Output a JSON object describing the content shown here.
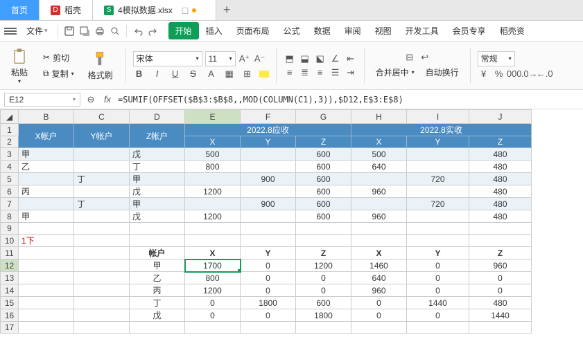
{
  "tabs": {
    "home": "首页",
    "docer": "稻壳",
    "file": "4模拟数据.xlsx"
  },
  "menubar": {
    "file": "文件"
  },
  "menutabs": {
    "start": "开始",
    "insert": "插入",
    "layout": "页面布局",
    "formula": "公式",
    "data": "数据",
    "review": "审阅",
    "view": "视图",
    "dev": "开发工具",
    "member": "会员专享",
    "docer": "稻壳资"
  },
  "ribbon": {
    "paste": "粘贴",
    "cut": "剪切",
    "copy": "复制",
    "brush": "格式刷",
    "font": "宋体",
    "size": "11",
    "merge": "合并居中",
    "wrap": "自动换行",
    "style": "常规"
  },
  "namebox": "E12",
  "formula": "=SUMIF(OFFSET($B$3:$B$8,,MOD(COLUMN(C1),3)),$D12,E$3:E$8)",
  "cols": [
    "B",
    "C",
    "D",
    "E",
    "F",
    "G",
    "H",
    "I",
    "J"
  ],
  "hdr": {
    "xacct": "X帐户",
    "yacct": "Y帐户",
    "zacct": "Z帐户",
    "ys": "2022.8应收",
    "ss": "2022.8实收",
    "x": "X",
    "y": "Y",
    "z": "Z"
  },
  "rows": [
    {
      "r": 3,
      "b": "甲",
      "c": "",
      "d": "戊",
      "e": "500",
      "f": "",
      "g": "600",
      "h": "500",
      "i": "",
      "j": "480"
    },
    {
      "r": 4,
      "b": "乙",
      "c": "",
      "d": "丁",
      "e": "800",
      "f": "",
      "g": "600",
      "h": "640",
      "i": "",
      "j": "480"
    },
    {
      "r": 5,
      "b": "",
      "c": "丁",
      "d": "甲",
      "e": "",
      "f": "900",
      "g": "600",
      "h": "",
      "i": "720",
      "j": "480"
    },
    {
      "r": 6,
      "b": "丙",
      "c": "",
      "d": "戊",
      "e": "1200",
      "f": "",
      "g": "600",
      "h": "960",
      "i": "",
      "j": "480"
    },
    {
      "r": 7,
      "b": "",
      "c": "丁",
      "d": "甲",
      "e": "",
      "f": "900",
      "g": "600",
      "h": "",
      "i": "720",
      "j": "480"
    },
    {
      "r": 8,
      "b": "甲",
      "c": "",
      "d": "戊",
      "e": "1200",
      "f": "",
      "g": "600",
      "h": "960",
      "i": "",
      "j": "480"
    }
  ],
  "marker": "1下",
  "sum": {
    "acctlbl": "帐户",
    "cols": [
      "X",
      "Y",
      "Z",
      "X",
      "Y",
      "Z"
    ],
    "rows": [
      {
        "r": 12,
        "d": "甲",
        "v": [
          "1700",
          "0",
          "1200",
          "1460",
          "0",
          "960"
        ]
      },
      {
        "r": 13,
        "d": "乙",
        "v": [
          "800",
          "0",
          "0",
          "640",
          "0",
          "0"
        ]
      },
      {
        "r": 14,
        "d": "丙",
        "v": [
          "1200",
          "0",
          "0",
          "960",
          "0",
          "0"
        ]
      },
      {
        "r": 15,
        "d": "丁",
        "v": [
          "0",
          "1800",
          "600",
          "0",
          "1440",
          "480"
        ]
      },
      {
        "r": 16,
        "d": "戊",
        "v": [
          "0",
          "0",
          "1800",
          "0",
          "0",
          "1440"
        ]
      }
    ]
  }
}
